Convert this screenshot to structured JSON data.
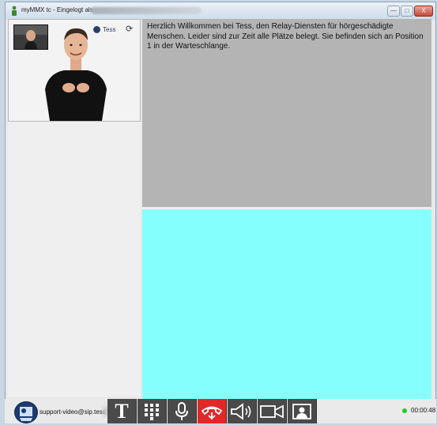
{
  "window": {
    "title": "myMMX tc - Eingelogt als",
    "minimize_glyph": "—",
    "maximize_glyph": "□",
    "close_glyph": "X"
  },
  "video": {
    "logo_text": "Tess",
    "refresh_icon": "refresh-icon"
  },
  "chat": {
    "message": "Herzlich Willkommen bei Tess, den Relay-Diensten für hörgeschädigte Menschen. Leider sind zur Zeit alle Plätze belegt. Sie befinden sich an Position 1 in der Warteschlange.",
    "input_value": ""
  },
  "status_bar": {
    "contact": "support-video@sip.tess-",
    "connection_color": "#22cc22",
    "timer": "00:00:48"
  },
  "toolbar": {
    "text_label": "T",
    "buttons": [
      "text-chat",
      "keypad",
      "microphone",
      "hang-up",
      "speaker",
      "camera",
      "self-view"
    ],
    "hangup_color": "#e02828"
  }
}
